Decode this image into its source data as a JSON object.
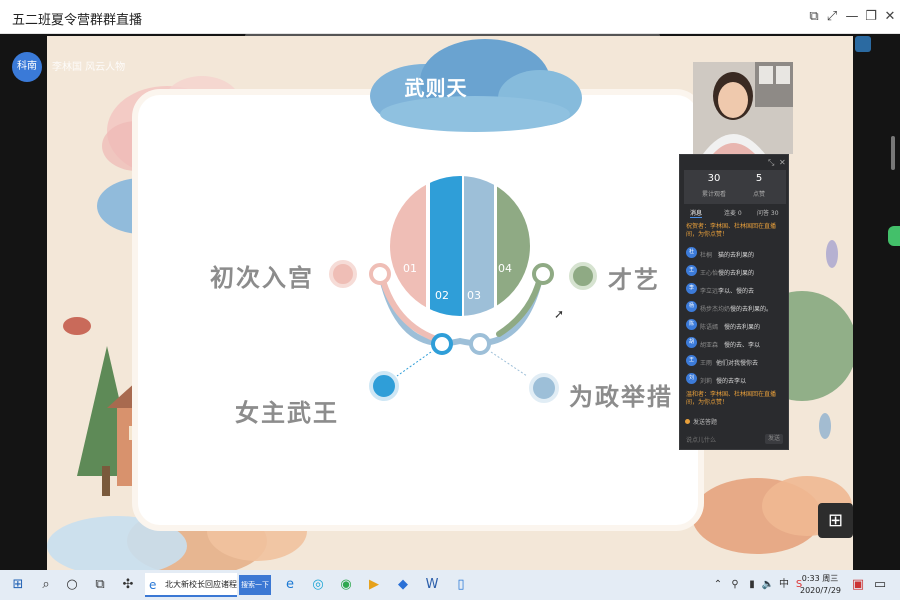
{
  "window": {
    "title": "五二班夏令营群群直播",
    "controls": [
      "restore-window-icon",
      "fullscreen-icon",
      "minimize-icon",
      "maximize-icon",
      "close-icon"
    ]
  },
  "presenter": {
    "avatar_label": "科南",
    "caption": "李林国 风云人物"
  },
  "slide": {
    "title": "武则天",
    "labels": {
      "top_left": "初次入宫",
      "top_right": "才艺",
      "bottom_left": "女主武王",
      "bottom_right": "为政举措"
    },
    "segments": [
      "01",
      "02",
      "03",
      "04"
    ],
    "colors": {
      "seg1": "#efbeb6",
      "seg2": "#2f9ed8",
      "seg3": "#9dbfd8",
      "seg4": "#8faa84",
      "title_cloud": "#6fa8cf"
    }
  },
  "chat": {
    "stats": [
      {
        "value": "30",
        "label": "累计观看"
      },
      {
        "value": "5",
        "label": "点赞"
      }
    ],
    "tabs": [
      "消息",
      "连麦 0",
      "问答 30"
    ],
    "system_top": "祝贺者：李林国、杜林国回在直播间，为你点赞！",
    "messages": [
      {
        "avatar": "杜",
        "name": "杜桐",
        "text": "猫的去利果的"
      },
      {
        "avatar": "王",
        "name": "王心怡",
        "text": "慢的去利果的"
      },
      {
        "avatar": "李",
        "name": "李立远",
        "text": "李以、慢的去"
      },
      {
        "avatar": "杨",
        "name": "杨步杰均奶",
        "text": "慢的去利果的。"
      },
      {
        "avatar": "陈",
        "name": "陈语嫣",
        "text": "慢的去利果的"
      },
      {
        "avatar": "胡",
        "name": "胡亚森",
        "text": "慢的去、李以"
      },
      {
        "avatar": "王",
        "name": "王雨",
        "text": "他们对我慢你去"
      },
      {
        "avatar": "刘",
        "name": "刘莉",
        "text": "慢的去李以"
      }
    ],
    "system_bottom": "温和者：李林国、杜林国回在直播间，为你点赞！",
    "hint": "发送答题",
    "input_placeholder": "说点儿什么",
    "send": "发送"
  },
  "taskbar": {
    "app_label": "北大新校长回应诸程",
    "search_label": "搜索一下",
    "time": "0:33 周三",
    "date": "2020/7/29"
  }
}
